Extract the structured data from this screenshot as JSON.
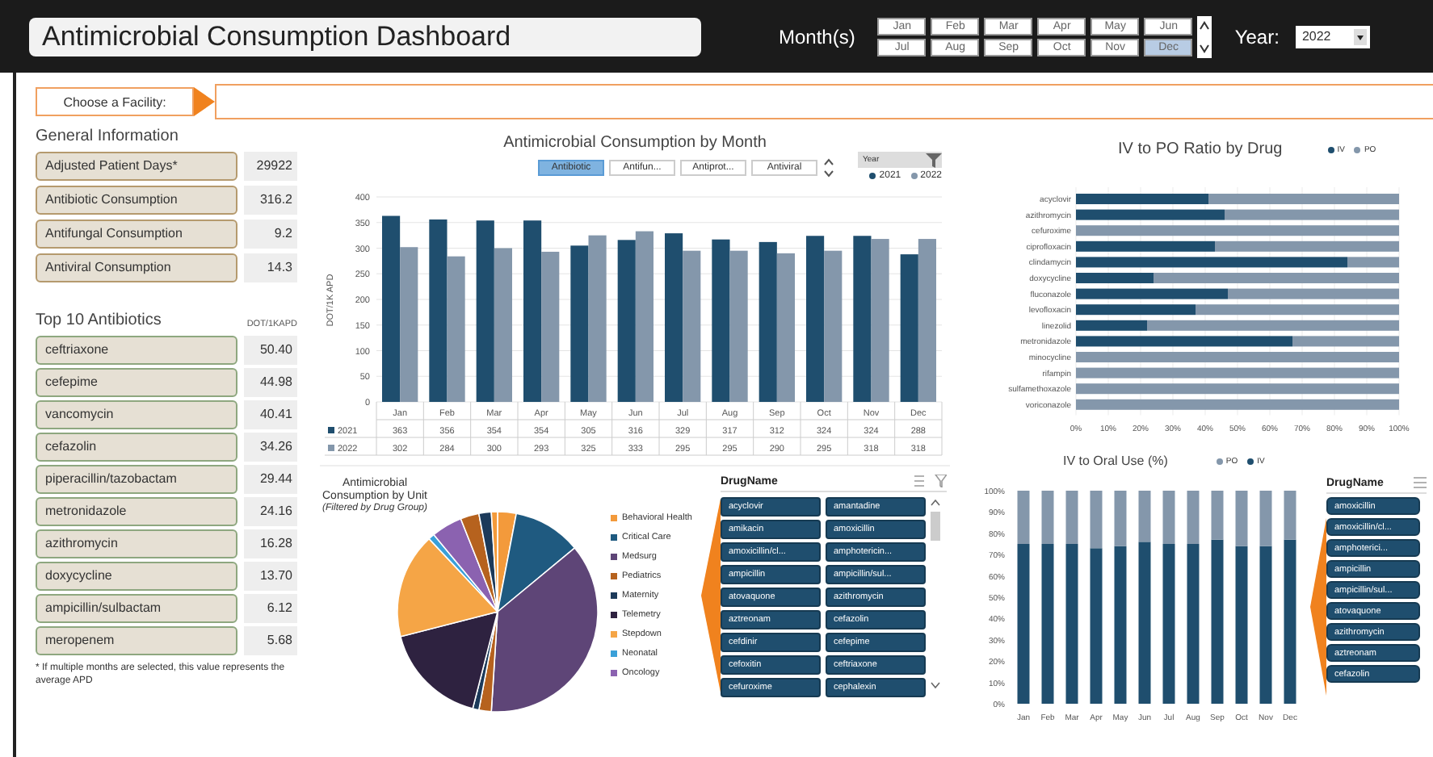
{
  "header": {
    "title": "Antimicrobial Consumption Dashboard",
    "months_label": "Month(s)",
    "months": [
      {
        "label": "Jan",
        "selected": false
      },
      {
        "label": "Feb",
        "selected": false
      },
      {
        "label": "Mar",
        "selected": false
      },
      {
        "label": "Apr",
        "selected": false
      },
      {
        "label": "May",
        "selected": false
      },
      {
        "label": "Jun",
        "selected": false
      },
      {
        "label": "Jul",
        "selected": false
      },
      {
        "label": "Aug",
        "selected": false
      },
      {
        "label": "Sep",
        "selected": false
      },
      {
        "label": "Oct",
        "selected": false
      },
      {
        "label": "Nov",
        "selected": false
      },
      {
        "label": "Dec",
        "selected": true
      }
    ],
    "year_label": "Year:",
    "year": "2022"
  },
  "facility": {
    "label": "Choose a Facility:"
  },
  "general": {
    "title": "General Information",
    "rows": [
      {
        "label": "Adjusted Patient Days*",
        "value": "29922"
      },
      {
        "label": "Antibiotic Consumption",
        "value": "316.2"
      },
      {
        "label": "Antifungal Consumption",
        "value": "9.2"
      },
      {
        "label": "Antiviral Consumption",
        "value": "14.3"
      }
    ]
  },
  "top10": {
    "title": "Top 10 Antibiotics",
    "unit": "DOT/1KAPD",
    "rows": [
      {
        "label": "ceftriaxone",
        "value": "50.40"
      },
      {
        "label": "cefepime",
        "value": "44.98"
      },
      {
        "label": "vancomycin",
        "value": "40.41"
      },
      {
        "label": "cefazolin",
        "value": "34.26"
      },
      {
        "label": "piperacillin/tazobactam",
        "value": "29.44"
      },
      {
        "label": "metronidazole",
        "value": "24.16"
      },
      {
        "label": "azithromycin",
        "value": "16.28"
      },
      {
        "label": "doxycycline",
        "value": "13.70"
      },
      {
        "label": "ampicillin/sulbactam",
        "value": "6.12"
      },
      {
        "label": "meropenem",
        "value": "5.68"
      }
    ]
  },
  "footnote": "* If multiple months are selected, this value represents the average APD",
  "consumption": {
    "tabs": [
      {
        "label": "Antibiotic",
        "selected": true
      },
      {
        "label": "Antifun...",
        "selected": false
      },
      {
        "label": "Antiprot...",
        "selected": false
      },
      {
        "label": "Antiviral",
        "selected": false
      }
    ],
    "year_filter": "Year",
    "chart_data": {
      "type": "bar",
      "title": "Antimicrobial Consumption by Month",
      "ylabel": "DOT/1K APD",
      "grid": true,
      "legend": "bottom-left",
      "categories": [
        "Jan",
        "Feb",
        "Mar",
        "Apr",
        "May",
        "Jun",
        "Jul",
        "Aug",
        "Sep",
        "Oct",
        "Nov",
        "Dec"
      ],
      "ylim": [
        0,
        400
      ],
      "yticks": [
        0,
        50,
        100,
        150,
        200,
        250,
        300,
        350,
        400
      ],
      "series": [
        {
          "name": "2021",
          "color": "#1f4e6e",
          "values": [
            363,
            356,
            354,
            354,
            305,
            316,
            329,
            317,
            312,
            324,
            324,
            288
          ]
        },
        {
          "name": "2022",
          "color": "#8497ab",
          "values": [
            302,
            284,
            300,
            293,
            325,
            333,
            295,
            295,
            290,
            295,
            318,
            318
          ]
        }
      ]
    },
    "table": [
      {
        "name": "2021",
        "cells": [
          "363",
          "356",
          "354",
          "354",
          "305",
          "316",
          "329",
          "317",
          "312",
          "324",
          "324",
          "288"
        ]
      },
      {
        "name": "2022",
        "cells": [
          "302",
          "284",
          "300",
          "293",
          "325",
          "333",
          "295",
          "295",
          "290",
          "295",
          "318",
          "318"
        ]
      }
    ]
  },
  "unit_pie": {
    "title": "Antimicrobial Consumption by Unit",
    "subtitle": "(Filtered by Drug Group)",
    "legend": [
      {
        "label": "Behavioral Health",
        "color": "#f39a3b"
      },
      {
        "label": "Critical Care",
        "color": "#1f5a80"
      },
      {
        "label": "Medsurg",
        "color": "#5e4577"
      },
      {
        "label": "Pediatrics",
        "color": "#b6621e"
      },
      {
        "label": "Maternity",
        "color": "#1c3a5a"
      },
      {
        "label": "Telemetry",
        "color": "#2e2240"
      },
      {
        "label": "Stepdown",
        "color": "#f5a546"
      },
      {
        "label": "Neonatal",
        "color": "#3aa0d8"
      },
      {
        "label": "Oncology",
        "color": "#8b62b0"
      }
    ]
  },
  "drug_slicer": {
    "title": "DrugName",
    "items": [
      "acyclovir",
      "amantadine",
      "amikacin",
      "amoxicillin",
      "amoxicillin/cl...",
      "amphotericin...",
      "ampicillin",
      "ampicillin/sul...",
      "atovaquone",
      "azithromycin",
      "aztreonam",
      "cefazolin",
      "cefdinir",
      "cefepime",
      "cefoxitin",
      "ceftriaxone",
      "cefuroxime",
      "cephalexin"
    ]
  },
  "iv_po": {
    "chart_data": {
      "type": "bar",
      "title": "IV to PO Ratio by Drug",
      "orientation": "horizontal",
      "stacked": true,
      "grid": true,
      "categories": [
        "acyclovir",
        "azithromycin",
        "cefuroxime",
        "ciprofloxacin",
        "clindamycin",
        "doxycycline",
        "fluconazole",
        "levofloxacin",
        "linezolid",
        "metronidazole",
        "minocycline",
        "rifampin",
        "sulfamethoxazole",
        "voriconazole"
      ],
      "xlim": [
        0,
        100
      ],
      "xticks": [
        {
          "value": 0,
          "label": "0%"
        },
        {
          "value": 10,
          "label": "10%"
        },
        {
          "value": 20,
          "label": "20%"
        },
        {
          "value": 30,
          "label": "30%"
        },
        {
          "value": 40,
          "label": "40%"
        },
        {
          "value": 50,
          "label": "50%"
        },
        {
          "value": 60,
          "label": "60%"
        },
        {
          "value": 70,
          "label": "70%"
        },
        {
          "value": 80,
          "label": "80%"
        },
        {
          "value": 90,
          "label": "90%"
        },
        {
          "value": 100,
          "label": "100%"
        }
      ],
      "series": [
        {
          "name": "IV",
          "color": "#1f4e6e",
          "values": [
            41,
            46,
            0,
            43,
            84,
            24,
            47,
            37,
            22,
            67,
            0,
            0,
            0,
            0
          ]
        },
        {
          "name": "PO",
          "color": "#8497ab",
          "values": [
            59,
            54,
            100,
            57,
            16,
            76,
            53,
            63,
            78,
            33,
            100,
            100,
            100,
            100
          ]
        }
      ]
    }
  },
  "iv_oral": {
    "chart_data": {
      "type": "bar",
      "title": "IV to Oral Use (%)",
      "stacked": true,
      "categories": [
        "Jan",
        "Feb",
        "Mar",
        "Apr",
        "May",
        "Jun",
        "Jul",
        "Aug",
        "Sep",
        "Oct",
        "Nov",
        "Dec"
      ],
      "ylim": [
        0,
        100
      ],
      "yticks": [
        {
          "value": 0,
          "label": "0%"
        },
        {
          "value": 10,
          "label": "10%"
        },
        {
          "value": 20,
          "label": "20%"
        },
        {
          "value": 30,
          "label": "30%"
        },
        {
          "value": 40,
          "label": "40%"
        },
        {
          "value": 50,
          "label": "50%"
        },
        {
          "value": 60,
          "label": "60%"
        },
        {
          "value": 70,
          "label": "70%"
        },
        {
          "value": 80,
          "label": "80%"
        },
        {
          "value": 90,
          "label": "90%"
        },
        {
          "value": 100,
          "label": "100%"
        }
      ],
      "series": [
        {
          "name": "IV",
          "color": "#1f4e6e",
          "values": [
            75,
            75,
            75,
            73,
            74,
            76,
            75,
            75,
            77,
            74,
            74,
            77
          ]
        },
        {
          "name": "PO",
          "color": "#8497ab",
          "values": [
            25,
            25,
            25,
            27,
            26,
            24,
            25,
            25,
            23,
            26,
            26,
            23
          ]
        }
      ]
    }
  },
  "drug_slicer_2": {
    "title": "DrugName",
    "items": [
      "amoxicillin",
      "amoxicillin/cl...",
      "amphoterici...",
      "ampicillin",
      "ampicillin/sul...",
      "atovaquone",
      "azithromycin",
      "aztreonam",
      "cefazolin"
    ]
  }
}
